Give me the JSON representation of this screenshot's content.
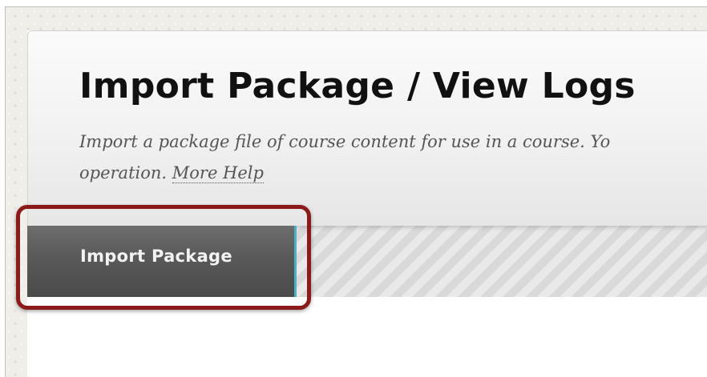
{
  "page": {
    "title": "Import Package / View Logs",
    "description_line1": "Import a package file of course content for use in a course. Yo",
    "description_line2": "operation.",
    "more_help_label": "More Help"
  },
  "tabs": [
    {
      "label": "Import Package",
      "active": true
    }
  ],
  "colors": {
    "highlight_border": "#8b1a1a",
    "tab_accent": "#4ab0c2",
    "tab_background": "#595959"
  }
}
